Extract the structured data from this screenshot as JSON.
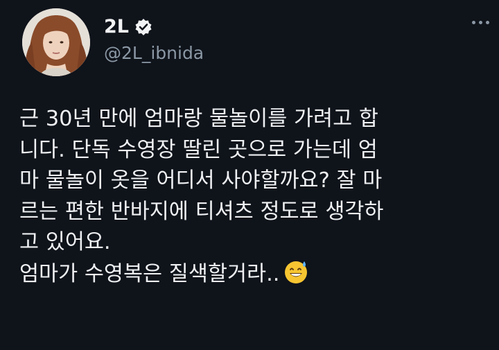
{
  "tweet": {
    "display_name": "2L",
    "handle": "@2L_ibnida",
    "verified": true,
    "icons": {
      "verified": "verified-badge-icon",
      "more": "more-options-icon",
      "emoji": "grinning-face-with-sweat-emoji"
    },
    "body_lines": [
      "근 30년 만에 엄마랑 물놀이를 가려고 합",
      "니다. 단독 수영장 딸린 곳으로 가는데 엄",
      "마 물놀이 옷을 어디서 사야할까요? 잘 마",
      "르는 편한 반바지에 티셔츠 정도로 생각하",
      "고 있어요.",
      "엄마가 수영복은 질색할거라.."
    ],
    "colors": {
      "background": "#0f131a",
      "text": "#eef0f2",
      "secondary": "#8b98a5"
    }
  }
}
